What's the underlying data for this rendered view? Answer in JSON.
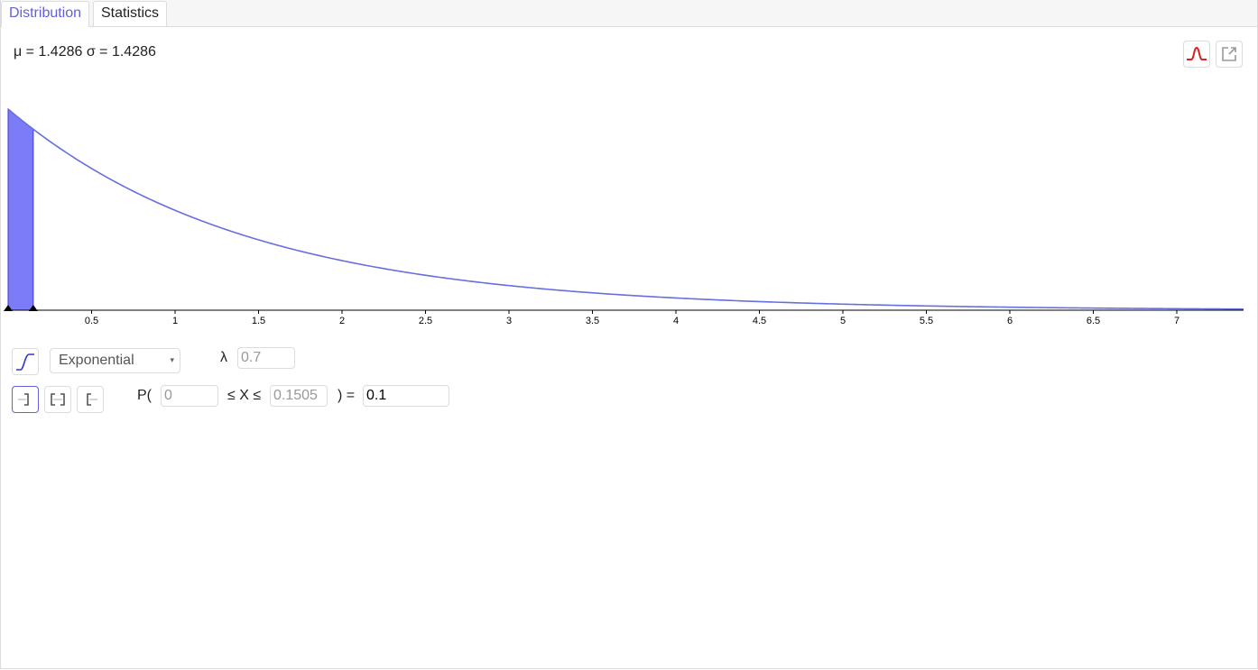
{
  "tabs": [
    {
      "label": "Distribution",
      "active": true
    },
    {
      "label": "Statistics",
      "active": false
    }
  ],
  "stats_text": "μ = 1.4286 σ = 1.4286",
  "toolbar": {
    "normal_overlay_icon": "bell-curve-icon",
    "export_icon": "export-icon",
    "accent_red": "#e02020"
  },
  "controls": {
    "cumulative_icon": "cumulative-curve-icon",
    "distribution_select": {
      "value": "Exponential",
      "caret": "▾"
    },
    "parameter": {
      "label": "λ",
      "value": "0.7"
    },
    "interval_buttons": [
      {
        "name": "left-sided",
        "selected": true
      },
      {
        "name": "interval",
        "selected": false
      },
      {
        "name": "right-sided",
        "selected": false
      }
    ],
    "probability": {
      "prefix": "P(",
      "lower": "0",
      "middle": "≤ X ≤",
      "upper": "0.1505",
      "suffix": ") =",
      "result": "0.1"
    }
  },
  "chart_data": {
    "type": "area",
    "function": "exponential pdf",
    "lambda": 0.7,
    "xlim": [
      0,
      7.4
    ],
    "ylim": [
      0,
      0.7
    ],
    "shaded_interval": [
      0,
      0.1505
    ],
    "x_ticks": [
      0.5,
      1,
      1.5,
      2,
      2.5,
      3,
      3.5,
      4,
      4.5,
      5,
      5.5,
      6,
      6.5,
      7
    ],
    "x_tick_labels": [
      "0.5",
      "1",
      "1.5",
      "2",
      "2.5",
      "3",
      "3.5",
      "4",
      "4.5",
      "5",
      "5.5",
      "6",
      "6.5",
      "7"
    ],
    "curve_color": "#6670dc",
    "fill_color": "#7d7cf8",
    "grid": false
  }
}
